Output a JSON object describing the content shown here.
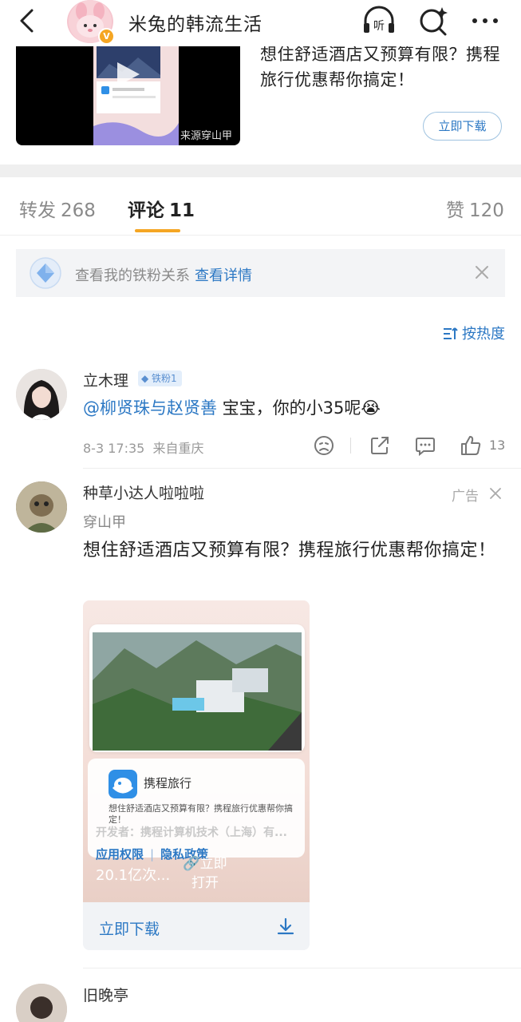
{
  "header": {
    "title": "米兔的韩流生活",
    "verified_badge": "V",
    "icons": [
      "back-arrow-icon",
      "headphones-listen-icon",
      "search-sparkle-icon",
      "more-dots-icon"
    ],
    "listen_label": "听"
  },
  "top_card": {
    "headline": "想住舒适酒店又预算有限？携程旅行优惠帮你搞定！",
    "source": "来源穿山甲",
    "download_label": "立即下载"
  },
  "tabs": [
    {
      "label": "转发",
      "count": "268"
    },
    {
      "label": "评论",
      "count": "11"
    },
    {
      "label": "赞",
      "count": "120"
    }
  ],
  "fan_banner": {
    "text": "查看我的铁粉关系",
    "link": "查看详情"
  },
  "sort": {
    "label": "按热度"
  },
  "comment": {
    "user": "立木理",
    "fan_badge": "铁粉1",
    "mention": "@柳贤珠与赵贤善",
    "text": " 宝宝，你的小35呢😭",
    "time": "8-3 17:35",
    "location": "来自重庆",
    "like_count": "13"
  },
  "ad_comment": {
    "user": "种草小达人啦啦啦",
    "ad_label": "广告",
    "source": "穿山甲",
    "text": "想住舒适酒店又预算有限？携程旅行优惠帮你搞定！",
    "card": {
      "app_name": "携程旅行",
      "app_desc": "想住舒适酒店又预算有限？携程旅行优惠帮你搞定！",
      "developer": "开发者：携程计算机技术（上海）有...",
      "permissions": "应用权限",
      "privacy": "隐私政策",
      "installs": "20.1亿次...",
      "open": "立即打开",
      "download": "立即下载"
    }
  },
  "next_comment": {
    "user": "旧晚亭"
  },
  "colors": {
    "accent": "#f5a623",
    "link": "#2c78c4",
    "divider": "#efefef"
  }
}
